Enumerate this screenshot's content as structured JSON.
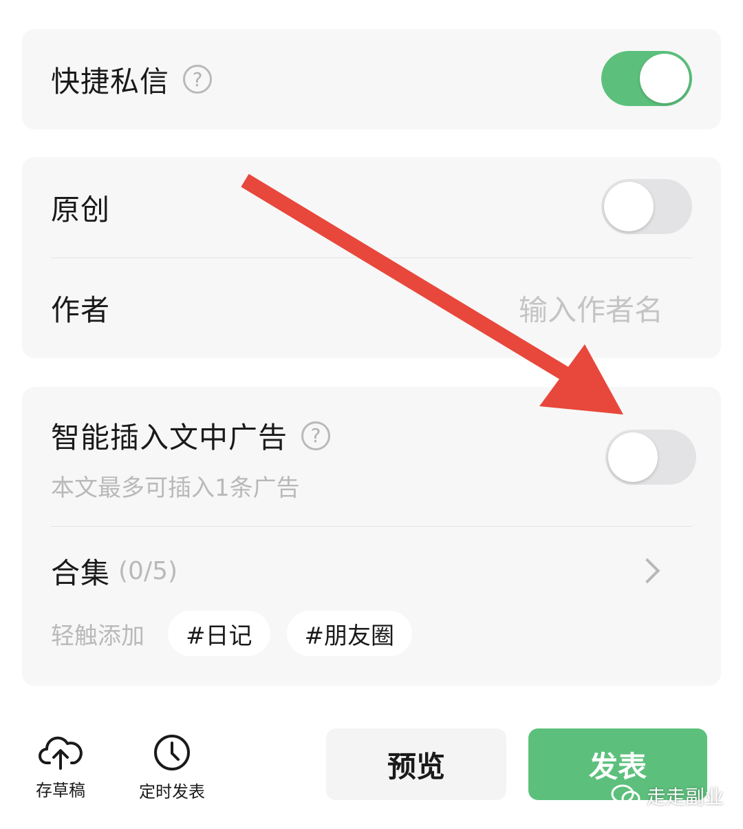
{
  "quick_message": {
    "label": "快捷私信",
    "help": "?",
    "enabled": true
  },
  "original": {
    "label": "原创",
    "enabled": false
  },
  "author": {
    "label": "作者",
    "placeholder": "输入作者名"
  },
  "smart_ads": {
    "label": "智能插入文中广告",
    "help": "?",
    "subtitle": "本文最多可插入1条广告",
    "enabled": false
  },
  "collection": {
    "label": "合集",
    "count": "(0/5)",
    "quick_add_label": "轻触添加",
    "tags": [
      "#日记",
      "#朋友圈"
    ]
  },
  "bottom": {
    "save_draft": "存草稿",
    "schedule": "定时发表",
    "preview": "预览",
    "publish": "发表"
  },
  "watermark": "走走副业",
  "colors": {
    "accent_green": "#5cc07c",
    "arrow_red": "#e8473b"
  }
}
